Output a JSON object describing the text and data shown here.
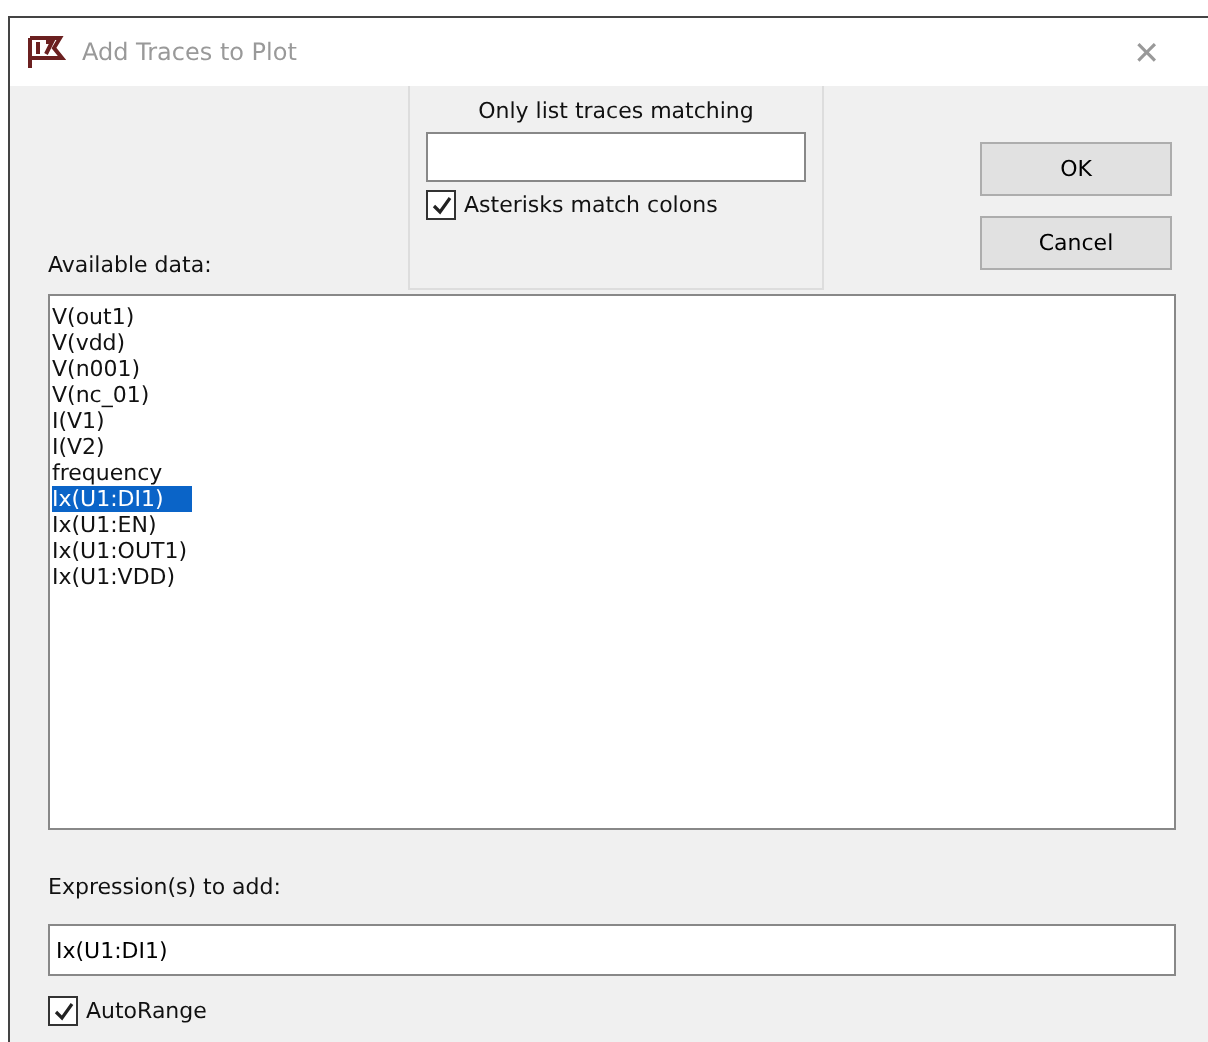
{
  "window": {
    "title": "Add Traces to Plot",
    "close": "✕"
  },
  "filter": {
    "label": "Only list traces matching",
    "asterisks": {
      "label": "Asterisks match colons",
      "checked": true
    }
  },
  "buttons": [
    "OK",
    "Cancel"
  ],
  "available": {
    "label": "Available data:",
    "items": [
      {
        "label": "V(out1)",
        "selected": false
      },
      {
        "label": "V(vdd)",
        "selected": false
      },
      {
        "label": "V(n001)",
        "selected": false
      },
      {
        "label": "V(nc_01)",
        "selected": false
      },
      {
        "label": "I(V1)",
        "selected": false
      },
      {
        "label": "I(V2)",
        "selected": false
      },
      {
        "label": "frequency",
        "selected": false
      },
      {
        "label": "Ix(U1:DI1)",
        "selected": true
      },
      {
        "label": "Ix(U1:EN)",
        "selected": false
      },
      {
        "label": "Ix(U1:OUT1)",
        "selected": false
      },
      {
        "label": "Ix(U1:VDD)",
        "selected": false
      }
    ]
  },
  "expression": {
    "label": "Expression(s) to add:",
    "value": "Ix(U1:DI1)"
  },
  "autorange": {
    "label": "AutoRange",
    "checked": true
  }
}
